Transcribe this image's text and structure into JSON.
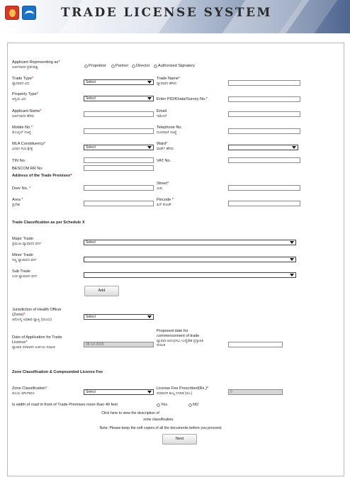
{
  "banner": {
    "title": "TRADE LICENSE SYSTEM"
  },
  "form": {
    "representing": {
      "label": "Applicant Representing as",
      "kn": "ಅರ್ಜಿದಾರರ ಪ್ರತಿನಿಧಿತ್ವ",
      "options": [
        "Proprietor",
        "Partner",
        "Director",
        "Authorized Signatory"
      ]
    },
    "trade_type": {
      "label": "Trade Type",
      "kn": "ವ್ಯಾಪಾರದ ವಿಧ",
      "value": "Select"
    },
    "trade_name": {
      "label": "Trade Name",
      "kn": "ವ್ಯಾಪಾರದ ಹೆಸರು"
    },
    "property_type": {
      "label": "Property Type",
      "kn": "ಆಸ್ತಿಯ ವಿಧ",
      "value": "Select"
    },
    "pid": {
      "label": "Enter PID/Khata/Survey No."
    },
    "applicant_name": {
      "label": "Applicant Name",
      "kn": "ಅರ್ಜಿದಾರರ ಹೆಸರು"
    },
    "email": {
      "label": "Email",
      "kn": "ಇಮೇಲ್"
    },
    "mobile": {
      "label": "Mobile No.",
      "kn": "ಮೊಬೈಲ್ ಸಂಖ್ಯೆ"
    },
    "telephone": {
      "label": "Telephone No.",
      "kn": "ದೂರವಾಣಿ ಸಂಖ್ಯೆ"
    },
    "mla": {
      "label": "MLA Constituency",
      "kn": "ವಿಧಾನ ಸಭಾ ಕ್ಷೇತ್ರ",
      "value": "Select"
    },
    "ward": {
      "label": "Ward",
      "kn": "ವಾರ್ಡ್ ಹೆಸರು",
      "value": ""
    },
    "tin": {
      "label": "TIN No."
    },
    "vat": {
      "label": "VAT No."
    },
    "bescom": {
      "label": "BESCOM RR No"
    },
    "address_header": "Address of the Trade Premises",
    "door": {
      "label": "Door No.",
      "kn": ""
    },
    "street": {
      "label": "Street",
      "kn": "ಬೀದಿ"
    },
    "area": {
      "label": "Area",
      "kn": "ಪ್ರದೇಶ"
    },
    "pincode": {
      "label": "Pincode",
      "kn": "ಪಿನ್ ಕೋಡ್"
    },
    "classification_header": "Trade Classification as per Schedule X",
    "major": {
      "label": "Major Trade",
      "kn": "ಪ್ರಮುಖ ವ್ಯಾಪಾರದ ವರ್ಗ",
      "value": "Select"
    },
    "minor": {
      "label": "Minor Trade",
      "kn": "ಸಣ್ಣ ವ್ಯಾಪಾರದ ವರ್ಗ",
      "value": ""
    },
    "sub": {
      "label": "Sub Trade",
      "kn": "ಉಪ ವ್ಯಾಪಾರದ ವರ್ಗ",
      "value": ""
    },
    "add_button": "Add",
    "health": {
      "label1": "Jurisdiction of Health Officer",
      "label2": "(Zone)",
      "kn": "ಆರೋಗ್ಯ ಅಧಿಕಾರಿ ವ್ಯಾಪ್ತಿ (ವಲಯ)",
      "value": "Select"
    },
    "date_app": {
      "label1": "Date of Application for Trade",
      "label2": "Licence",
      "kn": "ವ್ಯಾಪಾರ ಪರವಾನಗಿ ಅರ್ಜಿಯ ದಿನಾಂಕ",
      "value": "08-10-2016"
    },
    "proposed": {
      "label1": "Proposed date for",
      "label2": "commencement of trade",
      "kn1": "ವ್ಯಾಪಾರ ಆರಂಭಿಸಲು ಉದ್ದೇಶಿತ ಪ್ರಸ್ತಾಪಿತ",
      "kn2": "ದಿನಾಂಕ"
    },
    "zone_header": "Zone Classification & Compounded Licence Fee",
    "zone": {
      "label": "Zone Classification",
      "kn": "ವಲಯ ವರ್ಗೀಕರಣ",
      "value": "Select"
    },
    "fee": {
      "label": "License Fee Prescribed(Rs.)",
      "kn": "ಪರವಾನಗಿ ಶುಲ್ಕ ನಿಗದಿತ (ರೂ.)",
      "value": "0"
    },
    "road": {
      "label": "Is width of road in front of Trade Premises more than 40 feet",
      "yes": "Yes",
      "no": "NO"
    },
    "click_note1": "Click here to view the description of",
    "click_note2": "zone classification.",
    "keep_note": "Note: Please keep the soft copies of all the documents before you proceed.",
    "next_button": "Next"
  }
}
